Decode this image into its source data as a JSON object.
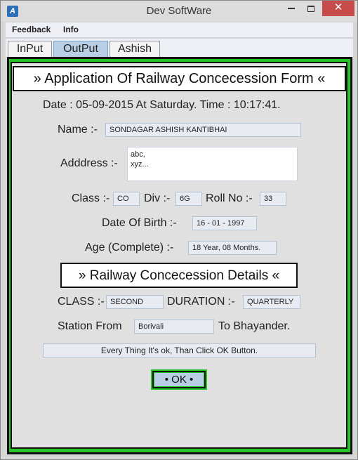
{
  "window": {
    "title": "Dev SoftWare",
    "icon_glyph": "A",
    "close_glyph": "✕"
  },
  "menu": [
    "Feedback",
    "Info"
  ],
  "tabs": [
    {
      "label": "InPut",
      "active": false
    },
    {
      "label": "OutPut",
      "active": true
    },
    {
      "label": "Ashish",
      "active": false
    }
  ],
  "form": {
    "heading": "» Application Of Railway Concecession Form «",
    "datetime_line": "Date : 05-09-2015  At Saturday.  Time : 10:17:41.",
    "name_label": "Name :-",
    "name_value": "SONDAGAR ASHISH KANTIBHAI",
    "address_label": "Adddress :-",
    "address_lines": [
      "abc,",
      "xyz..."
    ],
    "class_label": "Class :-",
    "class_value": "CO",
    "div_label": "Div :-",
    "div_value": "6G",
    "roll_label": "Roll No :-",
    "roll_value": "33",
    "dob_label": "Date Of Birth :-",
    "dob_value": "16 - 01 - 1997",
    "age_label": "Age (Complete) :-",
    "age_value": "18 Year,  08 Months."
  },
  "details": {
    "heading": "» Railway Concecession Details «",
    "class_label": "CLASS :-",
    "class_value": "SECOND",
    "duration_label": "DURATION :-",
    "duration_value": "QUARTERLY",
    "station_from_label": "Station From",
    "station_from_value": "Borivali",
    "station_to_label": "To Bhayander."
  },
  "status_message": "Every Thing It's ok, Than Click OK Button.",
  "ok_label": "• OK •",
  "colors": {
    "accent_green": "#27c427",
    "tab_active": "#b8cfe5",
    "close_red": "#c74b4b"
  }
}
